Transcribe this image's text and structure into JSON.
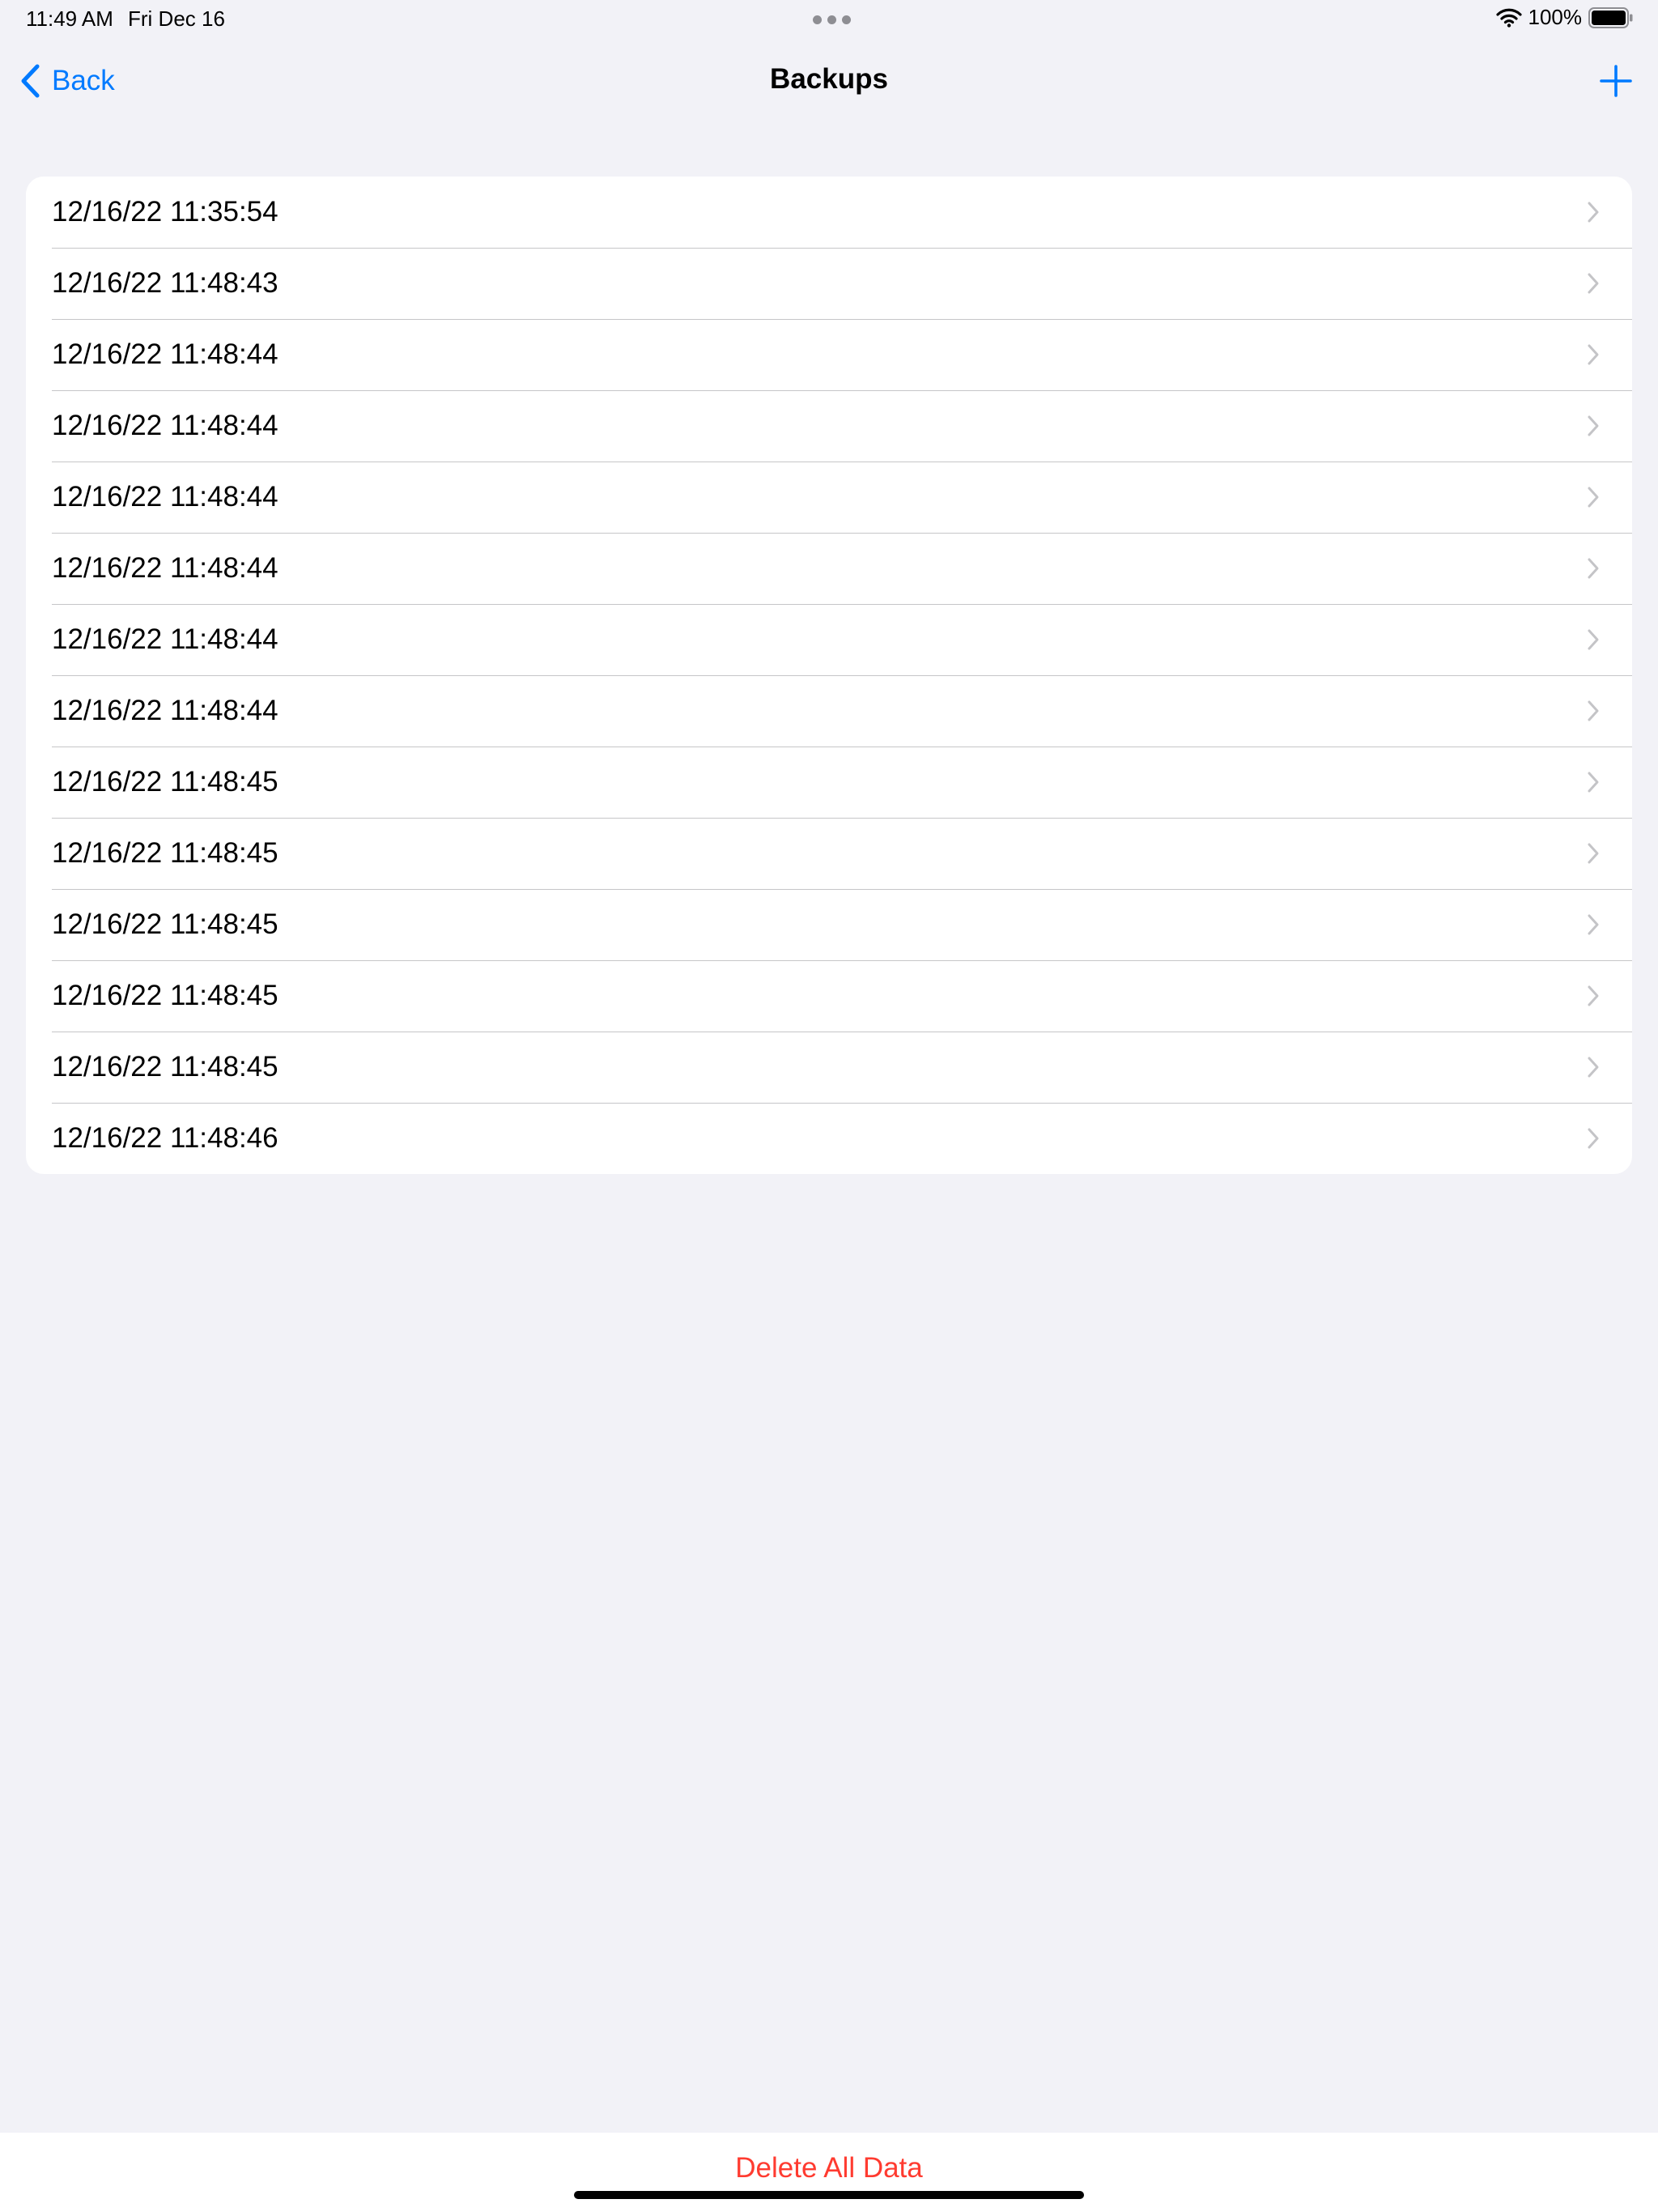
{
  "status_bar": {
    "time": "11:49 AM",
    "date": "Fri Dec 16",
    "battery": "100%"
  },
  "nav": {
    "back_label": "Back",
    "title": "Backups"
  },
  "backups": [
    "12/16/22 11:35:54",
    "12/16/22 11:48:43",
    "12/16/22 11:48:44",
    "12/16/22 11:48:44",
    "12/16/22 11:48:44",
    "12/16/22 11:48:44",
    "12/16/22 11:48:44",
    "12/16/22 11:48:44",
    "12/16/22 11:48:45",
    "12/16/22 11:48:45",
    "12/16/22 11:48:45",
    "12/16/22 11:48:45",
    "12/16/22 11:48:45",
    "12/16/22 11:48:46"
  ],
  "toolbar": {
    "delete_label": "Delete All Data"
  },
  "colors": {
    "accent": "#007aff",
    "destructive": "#ff3b30",
    "background": "#f2f2f7"
  },
  "icons": {
    "back": "chevron-left-icon",
    "add": "plus-icon",
    "row": "chevron-right-icon",
    "wifi": "wifi-icon",
    "battery": "battery-icon"
  }
}
